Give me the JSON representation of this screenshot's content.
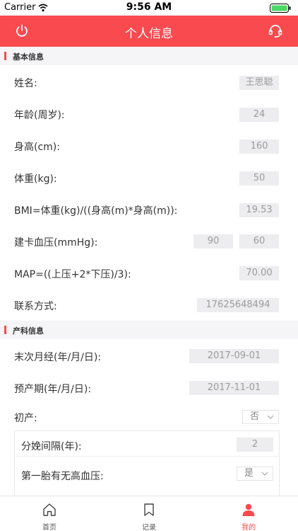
{
  "status_bar": {
    "carrier": "Carrier",
    "time": "9:56 AM"
  },
  "nav": {
    "title": "个人信息",
    "left_icon": "power-icon",
    "right_icon": "customer-service-icon"
  },
  "sections": {
    "basic": "基本信息",
    "obstetric": "产科信息"
  },
  "fields": {
    "name": {
      "label": "姓名:",
      "value": "王思聪"
    },
    "age": {
      "label": "年龄(周岁):",
      "value": "24"
    },
    "height": {
      "label": "身高(cm):",
      "value": "160"
    },
    "weight": {
      "label": "体重(kg):",
      "value": "50"
    },
    "bmi": {
      "label": "BMI=体重(kg)/((身高(m)*身高(m)):",
      "value": "19.53"
    },
    "bp": {
      "label": "建卡血压(mmHg):",
      "systolic": "90",
      "diastolic": "60"
    },
    "map": {
      "label": "MAP=((上压+2*下压)/3):",
      "value": "70.00"
    },
    "contact": {
      "label": "联系方式:",
      "value": "17625648494"
    },
    "lmp": {
      "label": "末次月经(年/月/日):",
      "value": "2017-09-01"
    },
    "edd": {
      "label": "预产期(年/月/日):",
      "value": "2017-11-01"
    },
    "primipara": {
      "label": "初产:",
      "value": "否"
    },
    "interval": {
      "label": "分娩间隔(年):",
      "value": "2"
    },
    "first_hypertension": {
      "label": "第一胎有无高血压:",
      "value": "是"
    }
  },
  "tabs": [
    {
      "label": "首页",
      "icon": "home-icon",
      "active": false
    },
    {
      "label": "记录",
      "icon": "bookmark-icon",
      "active": false
    },
    {
      "label": "我的",
      "icon": "user-icon",
      "active": true
    }
  ],
  "colors": {
    "accent": "#f84a4f",
    "field_bg": "#ededf0",
    "section_bg": "#f5f5f7"
  }
}
